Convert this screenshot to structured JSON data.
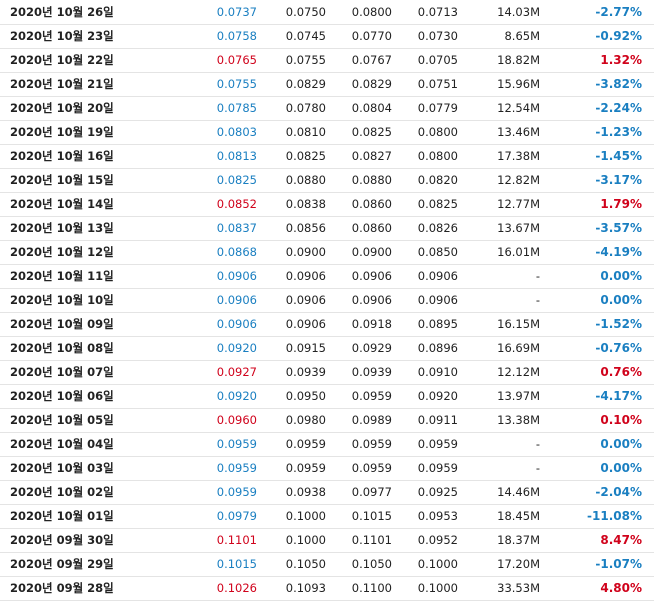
{
  "colors": {
    "up": "#d0021b",
    "down": "#1a7fc1",
    "text": "#222222",
    "divider": "#e4e4e4"
  },
  "rows": [
    {
      "date": "2020년 10월 26일",
      "close": "0.0737",
      "open": "0.0750",
      "high": "0.0800",
      "low": "0.0713",
      "volume": "14.03M",
      "change": "-2.77%",
      "dir": "down"
    },
    {
      "date": "2020년 10월 23일",
      "close": "0.0758",
      "open": "0.0745",
      "high": "0.0770",
      "low": "0.0730",
      "volume": "8.65M",
      "change": "-0.92%",
      "dir": "down"
    },
    {
      "date": "2020년 10월 22일",
      "close": "0.0765",
      "open": "0.0755",
      "high": "0.0767",
      "low": "0.0705",
      "volume": "18.82M",
      "change": "1.32%",
      "dir": "up"
    },
    {
      "date": "2020년 10월 21일",
      "close": "0.0755",
      "open": "0.0829",
      "high": "0.0829",
      "low": "0.0751",
      "volume": "15.96M",
      "change": "-3.82%",
      "dir": "down"
    },
    {
      "date": "2020년 10월 20일",
      "close": "0.0785",
      "open": "0.0780",
      "high": "0.0804",
      "low": "0.0779",
      "volume": "12.54M",
      "change": "-2.24%",
      "dir": "down"
    },
    {
      "date": "2020년 10월 19일",
      "close": "0.0803",
      "open": "0.0810",
      "high": "0.0825",
      "low": "0.0800",
      "volume": "13.46M",
      "change": "-1.23%",
      "dir": "down"
    },
    {
      "date": "2020년 10월 16일",
      "close": "0.0813",
      "open": "0.0825",
      "high": "0.0827",
      "low": "0.0800",
      "volume": "17.38M",
      "change": "-1.45%",
      "dir": "down"
    },
    {
      "date": "2020년 10월 15일",
      "close": "0.0825",
      "open": "0.0880",
      "high": "0.0880",
      "low": "0.0820",
      "volume": "12.82M",
      "change": "-3.17%",
      "dir": "down"
    },
    {
      "date": "2020년 10월 14일",
      "close": "0.0852",
      "open": "0.0838",
      "high": "0.0860",
      "low": "0.0825",
      "volume": "12.77M",
      "change": "1.79%",
      "dir": "up"
    },
    {
      "date": "2020년 10월 13일",
      "close": "0.0837",
      "open": "0.0856",
      "high": "0.0860",
      "low": "0.0826",
      "volume": "13.67M",
      "change": "-3.57%",
      "dir": "down"
    },
    {
      "date": "2020년 10월 12일",
      "close": "0.0868",
      "open": "0.0900",
      "high": "0.0900",
      "low": "0.0850",
      "volume": "16.01M",
      "change": "-4.19%",
      "dir": "down"
    },
    {
      "date": "2020년 10월 11일",
      "close": "0.0906",
      "open": "0.0906",
      "high": "0.0906",
      "low": "0.0906",
      "volume": "-",
      "change": "0.00%",
      "dir": "flat"
    },
    {
      "date": "2020년 10월 10일",
      "close": "0.0906",
      "open": "0.0906",
      "high": "0.0906",
      "low": "0.0906",
      "volume": "-",
      "change": "0.00%",
      "dir": "flat"
    },
    {
      "date": "2020년 10월 09일",
      "close": "0.0906",
      "open": "0.0906",
      "high": "0.0918",
      "low": "0.0895",
      "volume": "16.15M",
      "change": "-1.52%",
      "dir": "down"
    },
    {
      "date": "2020년 10월 08일",
      "close": "0.0920",
      "open": "0.0915",
      "high": "0.0929",
      "low": "0.0896",
      "volume": "16.69M",
      "change": "-0.76%",
      "dir": "down"
    },
    {
      "date": "2020년 10월 07일",
      "close": "0.0927",
      "open": "0.0939",
      "high": "0.0939",
      "low": "0.0910",
      "volume": "12.12M",
      "change": "0.76%",
      "dir": "up"
    },
    {
      "date": "2020년 10월 06일",
      "close": "0.0920",
      "open": "0.0950",
      "high": "0.0959",
      "low": "0.0920",
      "volume": "13.97M",
      "change": "-4.17%",
      "dir": "down"
    },
    {
      "date": "2020년 10월 05일",
      "close": "0.0960",
      "open": "0.0980",
      "high": "0.0989",
      "low": "0.0911",
      "volume": "13.38M",
      "change": "0.10%",
      "dir": "up"
    },
    {
      "date": "2020년 10월 04일",
      "close": "0.0959",
      "open": "0.0959",
      "high": "0.0959",
      "low": "0.0959",
      "volume": "-",
      "change": "0.00%",
      "dir": "flat"
    },
    {
      "date": "2020년 10월 03일",
      "close": "0.0959",
      "open": "0.0959",
      "high": "0.0959",
      "low": "0.0959",
      "volume": "-",
      "change": "0.00%",
      "dir": "flat"
    },
    {
      "date": "2020년 10월 02일",
      "close": "0.0959",
      "open": "0.0938",
      "high": "0.0977",
      "low": "0.0925",
      "volume": "14.46M",
      "change": "-2.04%",
      "dir": "down"
    },
    {
      "date": "2020년 10월 01일",
      "close": "0.0979",
      "open": "0.1000",
      "high": "0.1015",
      "low": "0.0953",
      "volume": "18.45M",
      "change": "-11.08%",
      "dir": "down"
    },
    {
      "date": "2020년 09월 30일",
      "close": "0.1101",
      "open": "0.1000",
      "high": "0.1101",
      "low": "0.0952",
      "volume": "18.37M",
      "change": "8.47%",
      "dir": "up"
    },
    {
      "date": "2020년 09월 29일",
      "close": "0.1015",
      "open": "0.1050",
      "high": "0.1050",
      "low": "0.1000",
      "volume": "17.20M",
      "change": "-1.07%",
      "dir": "down"
    },
    {
      "date": "2020년 09월 28일",
      "close": "0.1026",
      "open": "0.1093",
      "high": "0.1100",
      "low": "0.1000",
      "volume": "33.53M",
      "change": "4.80%",
      "dir": "up"
    }
  ]
}
